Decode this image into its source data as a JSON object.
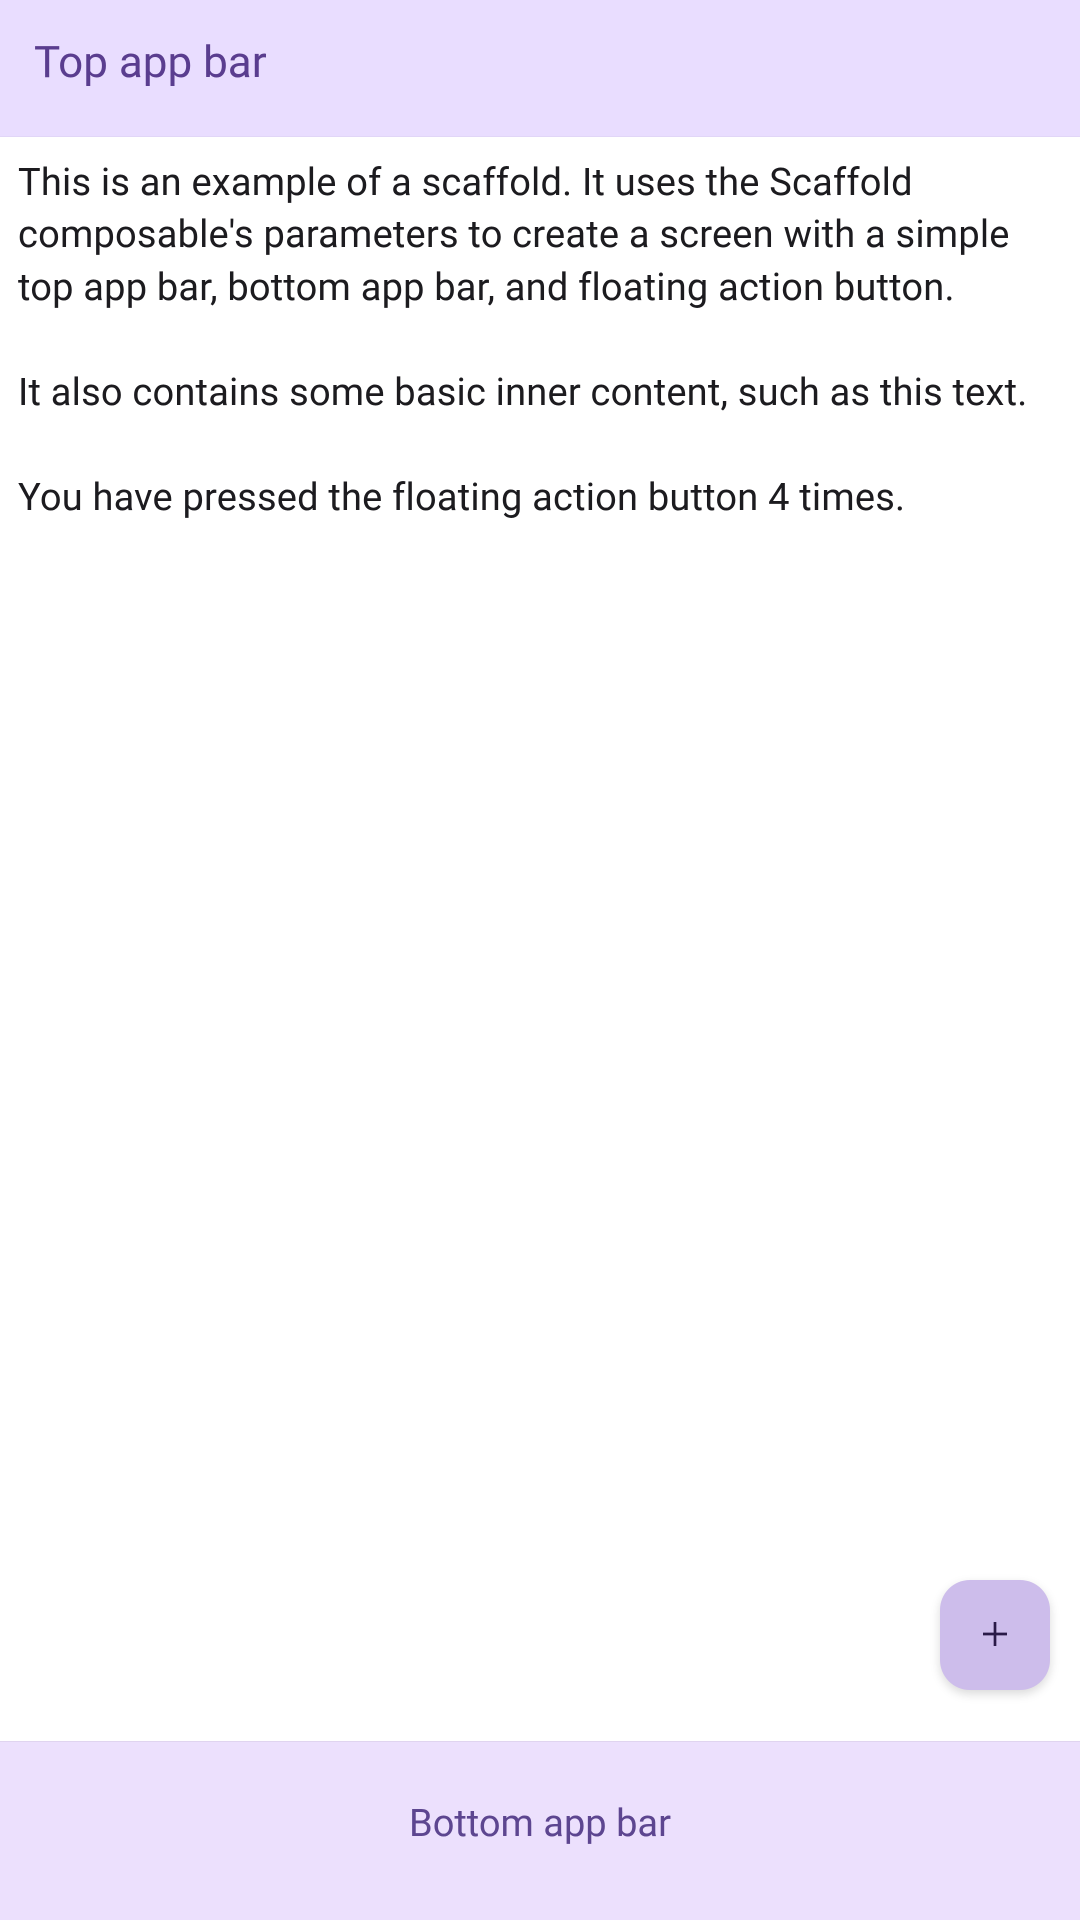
{
  "topAppBar": {
    "title": "Top app bar"
  },
  "content": {
    "paragraph1": "This is an example of a scaffold. It uses the Scaffold composable's parameters to create a screen with a simple top app bar, bottom app bar, and floating action button.",
    "paragraph2": "It also contains some basic inner content, such as this text.",
    "paragraph3": "You have pressed the floating action button 4 times."
  },
  "bottomAppBar": {
    "label": "Bottom app bar"
  },
  "fab": {
    "iconName": "add-icon"
  },
  "pressCount": 4
}
